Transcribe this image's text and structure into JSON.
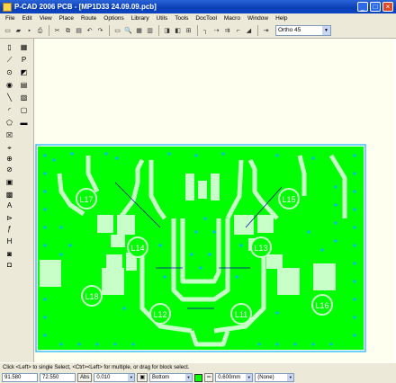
{
  "window": {
    "title": "P-CAD 2006 PCB - [MP1D33  24.09.09.pcb]"
  },
  "menu": [
    "File",
    "Edit",
    "View",
    "Place",
    "Route",
    "Options",
    "Library",
    "Utils",
    "Tools",
    "DocTool",
    "Macro",
    "Window",
    "Help"
  ],
  "toolbar": {
    "ortho_mode": "Ortho 45"
  },
  "board": {
    "labels": [
      "L17",
      "L13",
      "L15",
      "L14",
      "L18",
      "L12",
      "L11",
      "L16"
    ],
    "colors": {
      "copper": "#00ff00",
      "trace": "#c8ffc8",
      "via": "#00b4ff",
      "outline": "#40c0ff",
      "background": "#fffff0"
    }
  },
  "status": {
    "hint": "Click <Left> to single Select, <Ctrl><Left> for multiple, or drag for block select."
  },
  "bottom": {
    "x": "91.580",
    "y": "72.550",
    "abs_label": "Abs",
    "grid": "0.010",
    "layer": "Bottom",
    "line_width": "0.600mm",
    "net": "(None)"
  }
}
